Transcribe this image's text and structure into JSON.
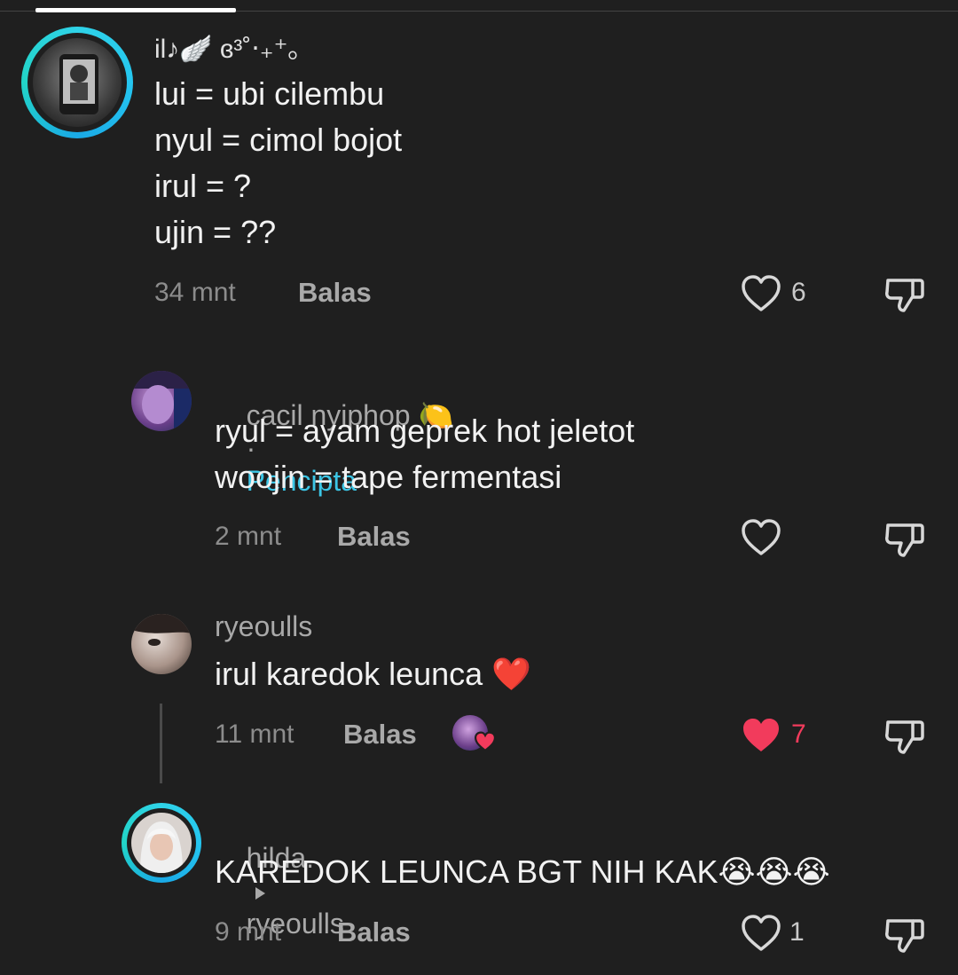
{
  "comments": [
    {
      "username": "il♪🪽 ɞ³˚‧₊⁺｡",
      "lines": [
        "lui = ubi cilembu",
        "nyul = cimol bojot",
        "irul = ?",
        "ujin = ??"
      ],
      "time": "34 mnt",
      "reply_label": "Balas",
      "likes": "6"
    },
    {
      "username": "cacil nyiphop 🍋",
      "separator": "·",
      "creator_tag": "Pencipta",
      "lines": [
        "ryul = ayam geprek hot jeletot",
        "woojin = tape fermentasi"
      ],
      "time": "2 mnt",
      "reply_label": "Balas"
    },
    {
      "username": "ryeoulls",
      "lines": [
        "irul karedok leunca ❤️"
      ],
      "time": "11 mnt",
      "reply_label": "Balas",
      "likes": "7"
    },
    {
      "username": "hilda.",
      "reply_to": "ryeoulls",
      "lines": [
        "KAREDOK LEUNCA BGT NIH KAK😭😭😭"
      ],
      "time": "9 mnt",
      "reply_label": "Balas",
      "likes": "1"
    }
  ],
  "colors": {
    "background": "#1f1f1f",
    "creator": "#3cc6e6",
    "liked_heart": "#f23b5c",
    "ring": "#2fd3e8"
  },
  "icons": [
    "heart-icon",
    "dislike-icon",
    "caret-right-icon"
  ]
}
